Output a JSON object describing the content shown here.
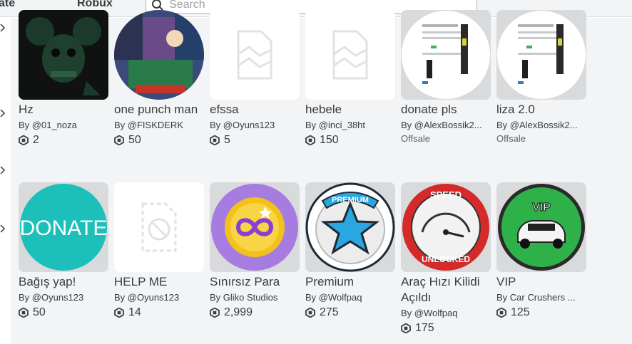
{
  "header": {
    "nav_create": "ate",
    "nav_robux": "Robux",
    "search_placeholder": "Search"
  },
  "rows": [
    [
      {
        "name": "Hz",
        "creator": "By @01_noza",
        "price": "2",
        "thumb": "mouse"
      },
      {
        "name": "one punch man",
        "creator": "By @FISKDERK",
        "price": "50",
        "thumb": "anime"
      },
      {
        "name": "efssa",
        "creator": "By @Oyuns123",
        "price": "5",
        "thumb": "placeholder"
      },
      {
        "name": "hebele",
        "creator": "By @inci_38ht",
        "price": "150",
        "thumb": "placeholder"
      },
      {
        "name": "donate pls",
        "creator": "By @AlexBossik2...",
        "offsale": "Offsale",
        "thumb": "screenshot"
      },
      {
        "name": "liza 2.0",
        "creator": "By @AlexBossik2...",
        "offsale": "Offsale",
        "thumb": "screenshot"
      }
    ],
    [
      {
        "name": "Bağış yap!",
        "creator": "By @Oyuns123",
        "price": "50",
        "thumb": "donate",
        "thumb_text": "DONATE"
      },
      {
        "name": "HELP ME",
        "creator": "By @Oyuns123",
        "price": "14",
        "thumb": "blocked"
      },
      {
        "name": "Sınırsız Para",
        "creator": "By Gliko Studios",
        "price": "2,999",
        "thumb": "infinity"
      },
      {
        "name": "Premium",
        "creator": "By @Wolfpaq",
        "price": "275",
        "thumb": "premium",
        "thumb_text": "PREMIUM"
      },
      {
        "name": "Araç Hızı Kilidi Açıldı",
        "creator": "By @Wolfpaq",
        "price": "175",
        "thumb": "speed",
        "thumb_text_top": "SPEED",
        "thumb_text_bottom": "UNLOCKED"
      },
      {
        "name": "VIP",
        "creator": "By Car Crushers ...",
        "price": "125",
        "thumb": "vip",
        "thumb_text": "VIP"
      }
    ]
  ]
}
